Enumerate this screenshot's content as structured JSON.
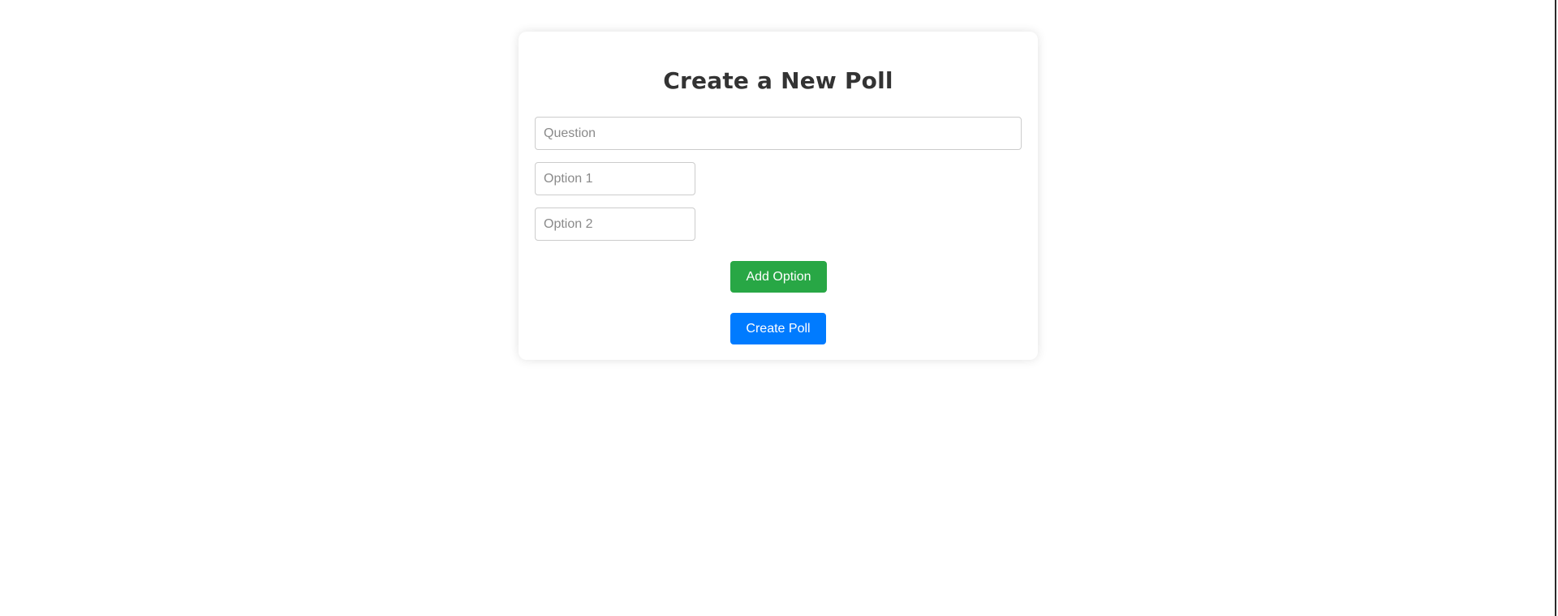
{
  "poll_form": {
    "title": "Create a New Poll",
    "question_placeholder": "Question",
    "option_1_placeholder": "Option 1",
    "option_2_placeholder": "Option 2",
    "add_option_label": "Add Option",
    "create_poll_label": "Create Poll"
  },
  "colors": {
    "add_option_button": "#28a745",
    "create_poll_button": "#007bff",
    "title_text": "#333333",
    "input_border": "#cccccc"
  }
}
